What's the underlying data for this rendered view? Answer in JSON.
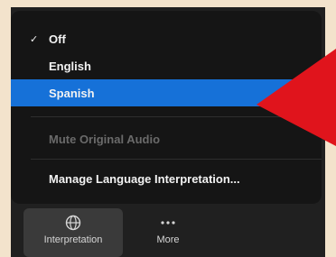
{
  "menu": {
    "items": [
      {
        "label": "Off",
        "checked": true
      },
      {
        "label": "English"
      },
      {
        "label": "Spanish",
        "selected": true
      },
      {
        "label": "Mute Original Audio",
        "disabled": true
      },
      {
        "label": "Manage Language Interpretation..."
      }
    ],
    "check_glyph": "✓"
  },
  "toolbar": {
    "interpretation": {
      "label": "Interpretation",
      "icon": "globe-icon"
    },
    "more": {
      "label": "More",
      "icon": "ellipsis-icon"
    }
  },
  "colors": {
    "selected": "#1671d8",
    "arrow": "#e0141c",
    "background": "#f3e3cc"
  }
}
